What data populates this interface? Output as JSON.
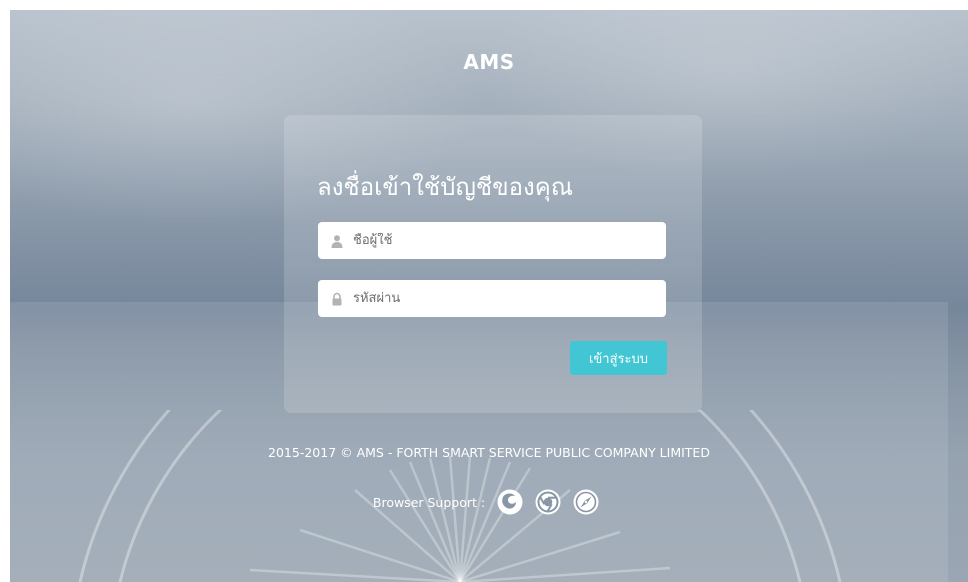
{
  "header": {
    "title": "AMS"
  },
  "login": {
    "heading": "ลงชื่อเข้าใช้บัญชีของคุณ",
    "username": {
      "placeholder": "ชื่อผู้ใช้",
      "value": "",
      "icon": "user-icon"
    },
    "password": {
      "placeholder": "รหัสผ่าน",
      "value": "",
      "icon": "lock-icon"
    },
    "submit_label": "เข้าสู่ระบบ"
  },
  "footer": {
    "copyright": "2015-2017 © AMS - FORTH SMART SERVICE PUBLIC COMPANY LIMITED",
    "browser_support_label": "Browser Support :",
    "browsers": [
      {
        "icon": "firefox-icon"
      },
      {
        "icon": "chrome-icon"
      },
      {
        "icon": "safari-icon"
      }
    ]
  },
  "colors": {
    "accent": "#43c6d4",
    "text_on_dark": "#ffffff"
  }
}
